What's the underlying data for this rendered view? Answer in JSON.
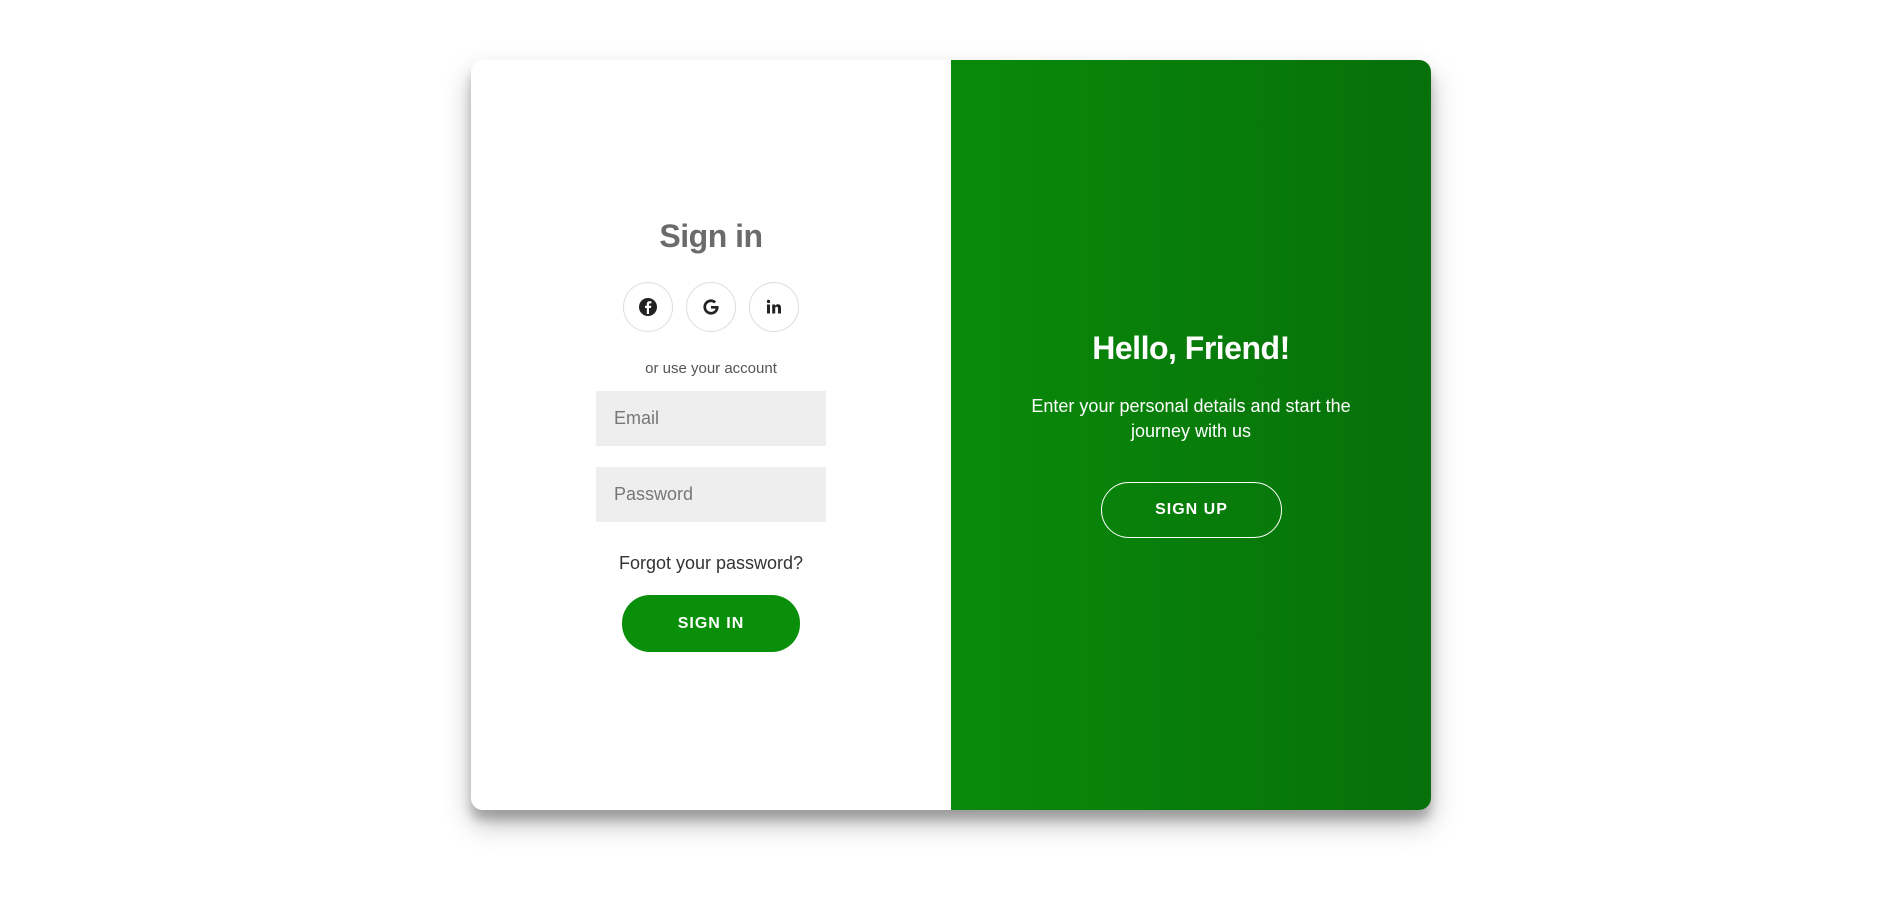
{
  "signin": {
    "title": "Sign in",
    "divider_text": "or use your account",
    "email_placeholder": "Email",
    "password_placeholder": "Password",
    "forgot_link": "Forgot your password?",
    "submit_label": "SIGN IN",
    "socials": [
      {
        "icon": "facebook-icon"
      },
      {
        "icon": "google-icon"
      },
      {
        "icon": "linkedin-icon"
      }
    ]
  },
  "overlay": {
    "title": "Hello, Friend!",
    "text": "Enter your personal details and start the journey with us",
    "button_label": "SIGN UP"
  },
  "colors": {
    "accent": "#0a8f0a",
    "panel_start": "#0a8a0a",
    "panel_end": "#06700a",
    "input_bg": "#eeeeee"
  }
}
